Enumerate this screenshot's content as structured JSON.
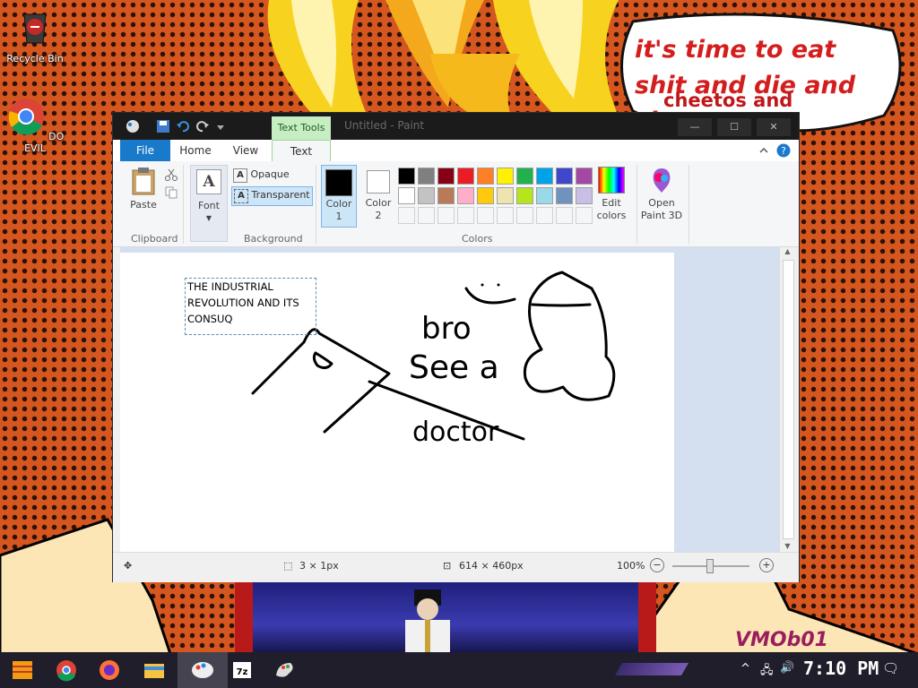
{
  "desktop": {
    "icons": [
      {
        "label": "Recycle Bin",
        "icon": "recycle-bin-icon"
      },
      {
        "label": "DO EVIL",
        "icon": "chrome-icon"
      }
    ],
    "bubble_text": "it's time to eat shit and die and chew",
    "bubble_text_overlap": "cheetos and",
    "bubble_text_tail": "w",
    "watermark": "VMOb01"
  },
  "window": {
    "title": "Untitled - Paint",
    "contextual_tab": "Text Tools",
    "controls": {
      "minimize": "—",
      "maximize": "☐",
      "close": "✕"
    },
    "tabs": [
      "File",
      "Home",
      "View",
      "Text"
    ],
    "ribbon": {
      "clipboard": {
        "paste": "Paste",
        "group": "Clipboard"
      },
      "font": {
        "label": "Font"
      },
      "background": {
        "opaque": "Opaque",
        "transparent": "Transparent",
        "group": "Background"
      },
      "colors": {
        "color1": "Color 1",
        "color2": "Color 2",
        "edit": "Edit colors",
        "group": "Colors",
        "palette_row1": [
          "#000000",
          "#7f7f7f",
          "#880015",
          "#ed1c24",
          "#ff7f27",
          "#fff200",
          "#22b14c",
          "#00a2e8",
          "#3f48cc",
          "#a349a4"
        ],
        "palette_row2": [
          "#ffffff",
          "#c3c3c3",
          "#b97a57",
          "#ffaec9",
          "#ffc90e",
          "#efe4b0",
          "#b5e61d",
          "#99d9ea",
          "#7092be",
          "#c8bfe7"
        ],
        "custom_slots": 10
      },
      "paint3d": {
        "label": "Open Paint 3D"
      }
    },
    "canvas_text": [
      "THE INDUSTRIAL",
      "REVOLUTION AND ITS",
      "CONSUQ"
    ],
    "drawing_words": [
      "bro",
      "See a",
      "doctor"
    ],
    "status": {
      "selection": "3 × 1px",
      "canvas_size": "614 × 460px",
      "zoom": "100%"
    }
  },
  "taskbar": {
    "clock": "7:10 PM",
    "apps": [
      "start",
      "chrome",
      "firefox",
      "file-explorer",
      "paint-active",
      "7zip",
      "paint"
    ]
  }
}
